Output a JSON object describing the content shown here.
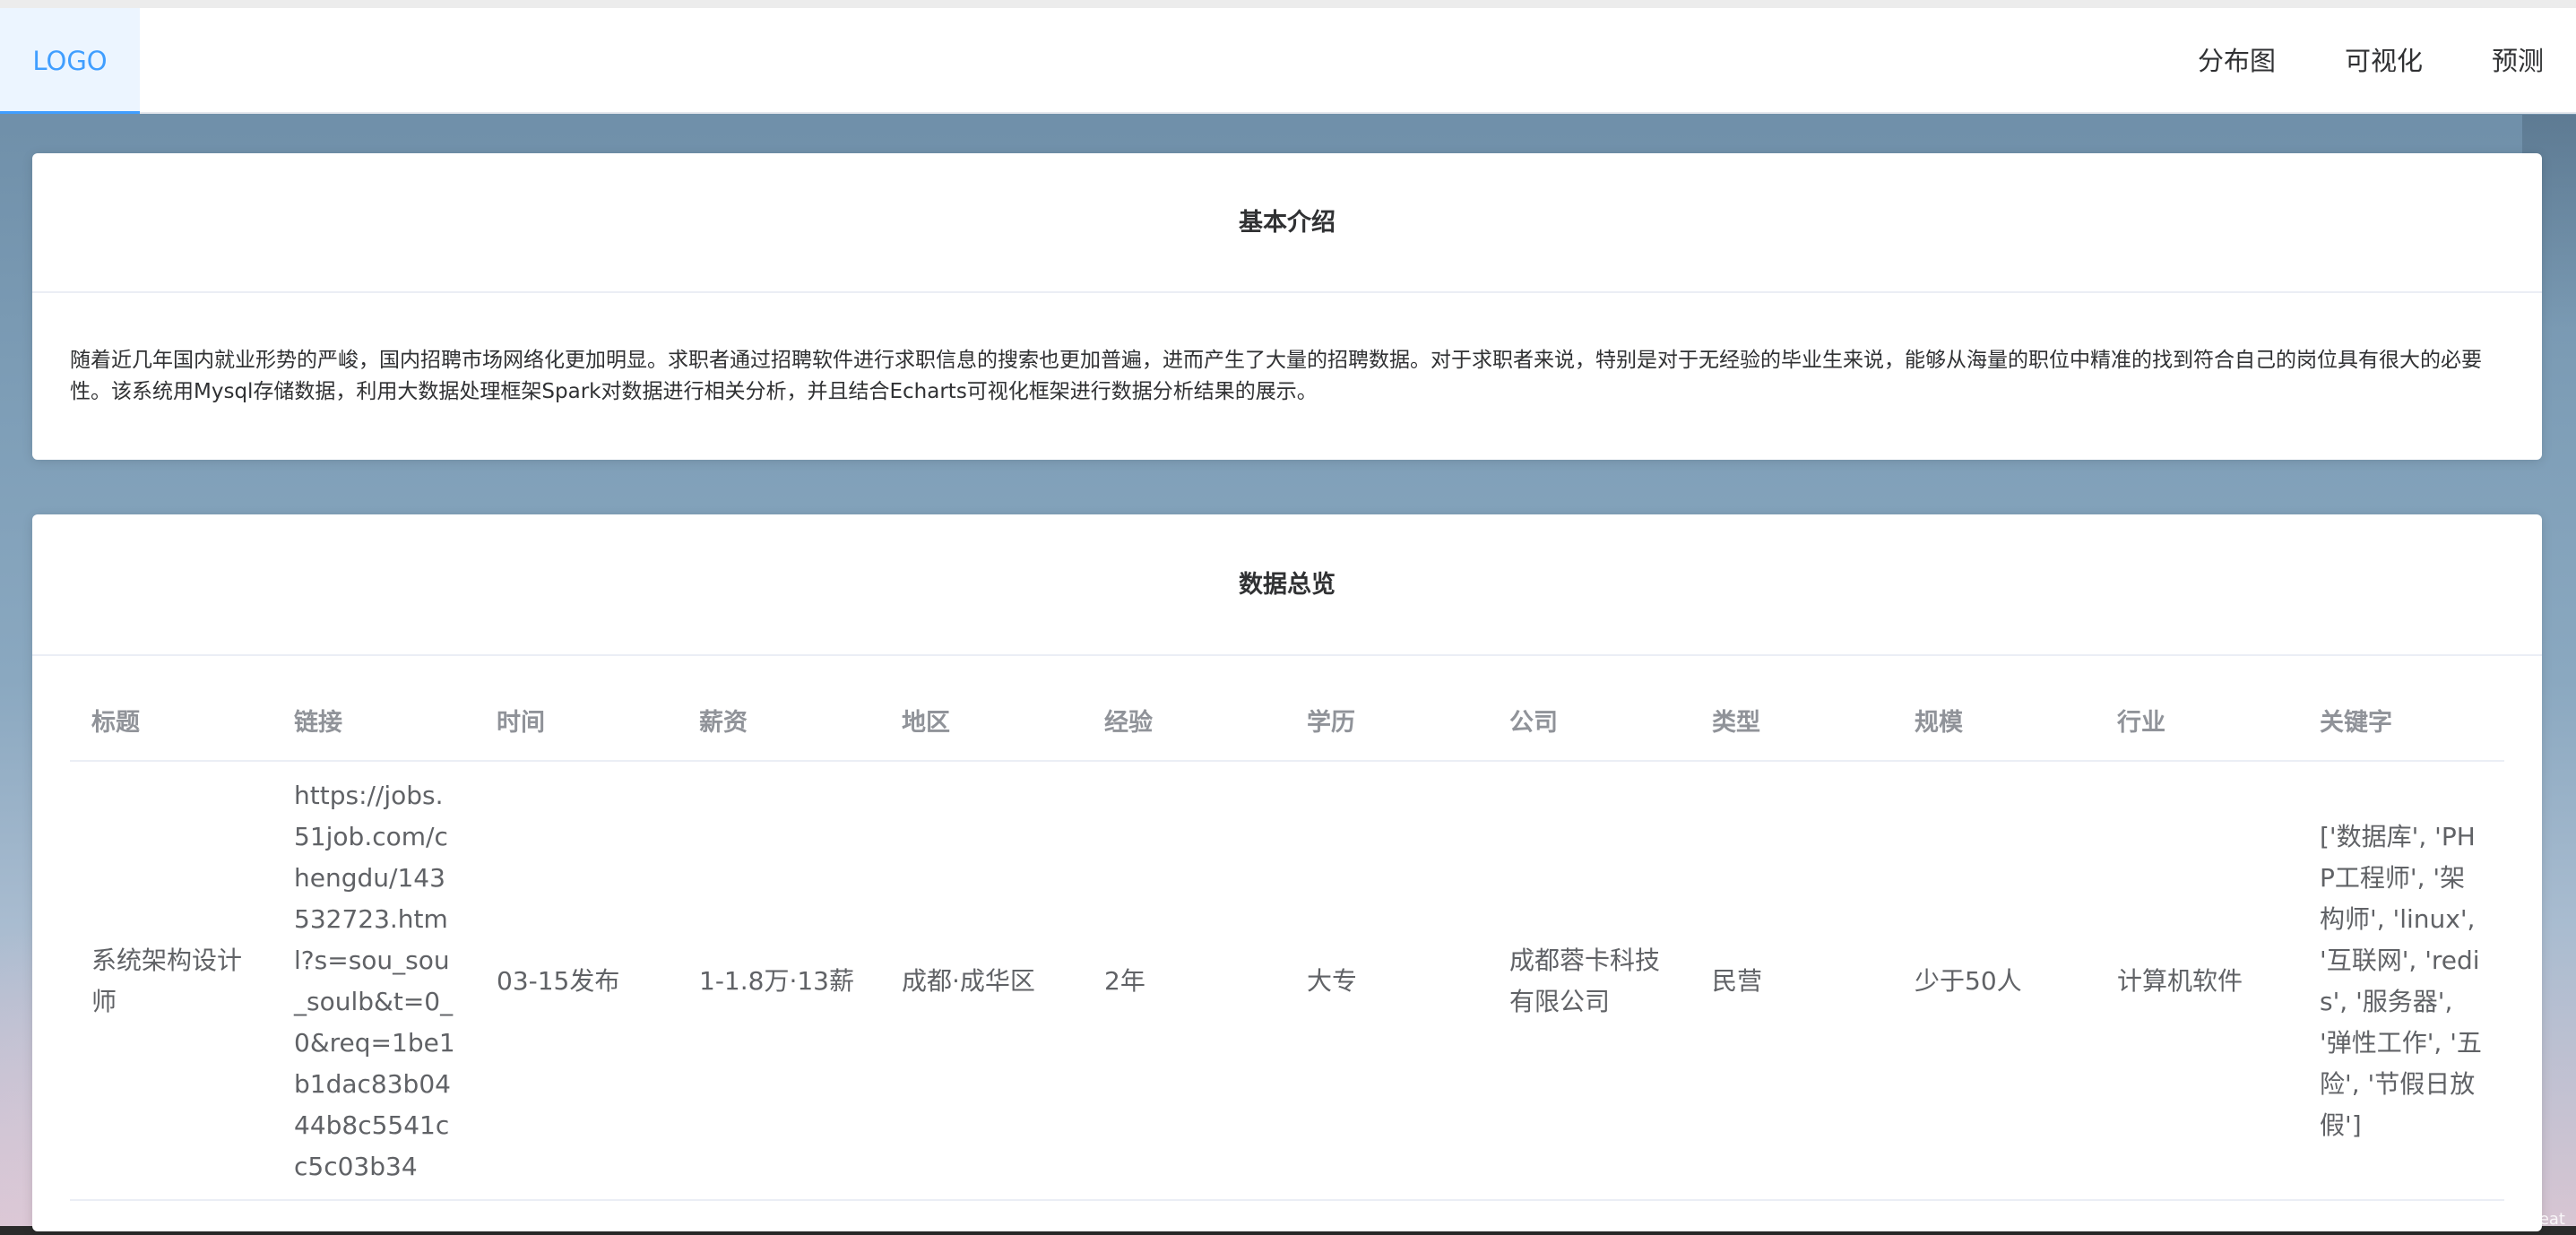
{
  "header": {
    "logo": "LOGO",
    "nav": [
      "分布图",
      "可视化",
      "预测"
    ]
  },
  "intro": {
    "title": "基本介绍",
    "text": "随着近几年国内就业形势的严峻，国内招聘市场网络化更加明显。求职者通过招聘软件进行求职信息的搜索也更加普遍，进而产生了大量的招聘数据。对于求职者来说，特别是对于无经验的毕业生来说，能够从海量的职位中精准的找到符合自己的岗位具有很大的必要性。该系统用Mysql存储数据，利用大数据处理框架Spark对数据进行相关分析，并且结合Echarts可视化框架进行数据分析结果的展示。"
  },
  "overview": {
    "title": "数据总览",
    "columns": [
      "标题",
      "链接",
      "时间",
      "薪资",
      "地区",
      "经验",
      "学历",
      "公司",
      "类型",
      "规模",
      "行业",
      "关键字"
    ],
    "rows": [
      [
        "系统架构设计师",
        "https://jobs.51job.com/chengdu/143532723.html?s=sou_sou_soulb&t=0_0&req=1be1b1dac83b0444b8c5541cc5c03b34",
        "03-15发布",
        "1-1.8万·13薪",
        "成都·成华区",
        "2年",
        "大专",
        "成都蓉卡科技有限公司",
        "民营",
        "少于50人",
        "计算机软件",
        "['数据库', 'PHP工程师', '架构师', 'linux', '互联网', 'redis', '服务器', '弹性工作', '五险', '节假日放假']"
      ]
    ]
  },
  "watermark": "CSDN @往事随风beat"
}
